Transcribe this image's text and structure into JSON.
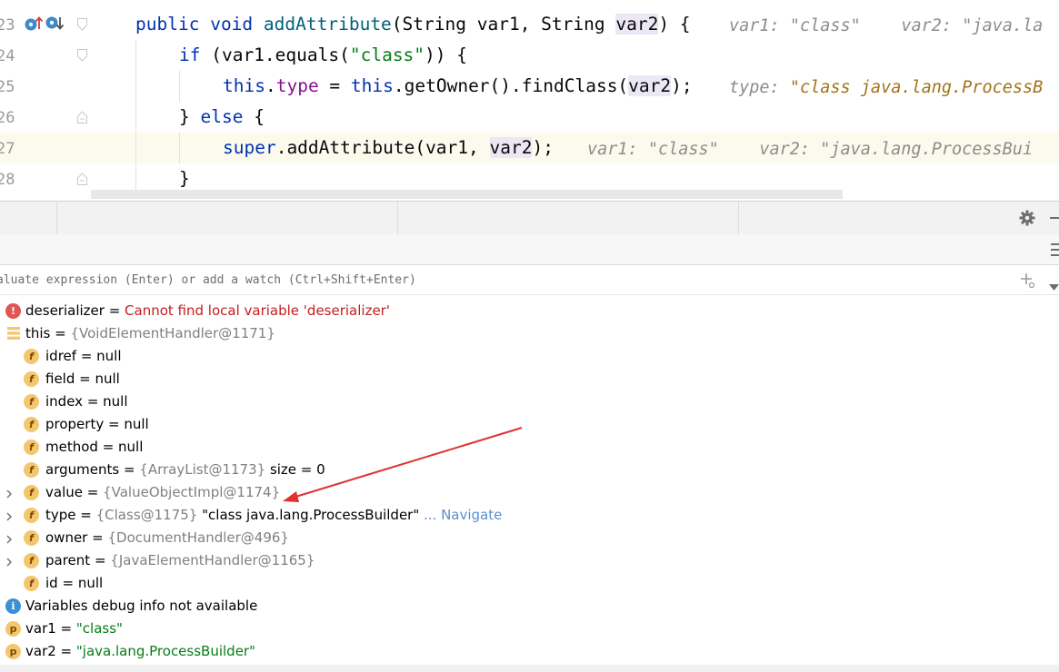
{
  "editor": {
    "lines": [
      {
        "num": "23"
      },
      {
        "num": "24"
      },
      {
        "num": "25"
      },
      {
        "num": "26"
      },
      {
        "num": "27"
      },
      {
        "num": "28"
      }
    ],
    "code": {
      "l23": {
        "kw1": "public",
        "kw2": "void",
        "method": "addAttribute",
        "p1": "(String var1, String ",
        "p2": "var2",
        "p3": ") {"
      },
      "l24": {
        "kw": "if",
        "a": " (var1.equals(",
        "str": "\"class\"",
        "b": ")) {"
      },
      "l25": {
        "kw": "this",
        "dot": ".",
        "fld": "type",
        "eq": " = ",
        "kw2": "this",
        "call": ".getOwner().findClass(",
        "arg": "var2",
        "end": ");"
      },
      "l26": {
        "t": "} ",
        "kw": "else",
        "t2": " {"
      },
      "l27": {
        "kw": "super",
        "call": ".addAttribute(var1, ",
        "arg": "var2",
        "end": ");"
      },
      "l28": {
        "t": "}"
      }
    },
    "hints": {
      "l23": {
        "n1": "var1: ",
        "v1": "\"class\"",
        "n2": "var2: ",
        "v2": "\"java.la"
      },
      "l25": {
        "n1": "type: ",
        "v1": "\"class java.lang.ProcessB"
      },
      "l27": {
        "n1": "var1: ",
        "v1": "\"class\"",
        "n2": "var2: ",
        "v2": "\"java.lang.ProcessBui"
      }
    }
  },
  "eval": {
    "placeholder": "aluate expression (Enter) or add a watch (Ctrl+Shift+Enter)"
  },
  "variables": {
    "deserializer": {
      "name": "deserializer",
      "eq": " = ",
      "value": "Cannot find local variable 'deserializer'"
    },
    "this": {
      "name": "this",
      "eq": " = ",
      "value": "{VoidElementHandler@1171}"
    },
    "fields": [
      {
        "name": "idref",
        "eq": " = ",
        "value": "null"
      },
      {
        "name": "field",
        "eq": " = ",
        "value": "null"
      },
      {
        "name": "index",
        "eq": " = ",
        "value": "null"
      },
      {
        "name": "property",
        "eq": " = ",
        "value": "null"
      },
      {
        "name": "method",
        "eq": " = ",
        "value": "null"
      }
    ],
    "arguments": {
      "name": "arguments",
      "eq": " = ",
      "ref": "{ArrayList@1173}",
      "extra": "  size = 0"
    },
    "value": {
      "name": "value",
      "eq": " = ",
      "ref": "{ValueObjectImpl@1174}"
    },
    "type": {
      "name": "type",
      "eq": " = ",
      "ref": "{Class@1175}",
      "extra": " \"class java.lang.ProcessBuilder\"",
      "nav": " ... Navigate"
    },
    "owner": {
      "name": "owner",
      "eq": " = ",
      "ref": "{DocumentHandler@496}"
    },
    "parent": {
      "name": "parent",
      "eq": " = ",
      "ref": "{JavaElementHandler@1165}"
    },
    "id": {
      "name": "id",
      "eq": " = ",
      "value": "null"
    },
    "info": {
      "text": "Variables debug info not available"
    },
    "var1": {
      "name": "var1",
      "eq": " = ",
      "value": "\"class\""
    },
    "var2": {
      "name": "var2",
      "eq": " = ",
      "value": "\"java.lang.ProcessBuilder\""
    }
  },
  "icons": {
    "field_letter": "f",
    "param_letter": "p",
    "error_glyph": "!",
    "info_glyph": "i"
  },
  "colors": {
    "keyword": "#0033b3",
    "method": "#00627a",
    "string": "#067d17",
    "field": "#871094",
    "error": "#c41e1e",
    "arrow": "#e03030"
  }
}
